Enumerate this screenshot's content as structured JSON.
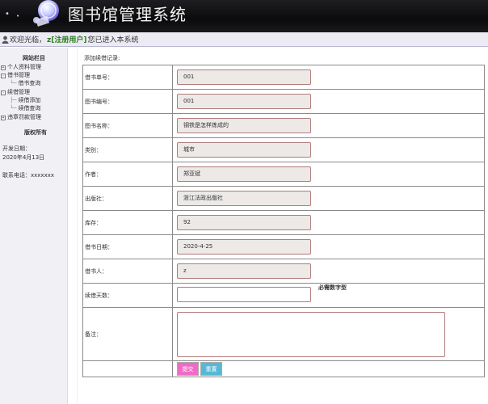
{
  "header": {
    "title": "图书馆管理系统"
  },
  "welcome": {
    "prefix": "欢迎光临，",
    "username": "z[注册用户]",
    "suffix": "您已进入本系统"
  },
  "sidebar": {
    "title": "网站栏目",
    "tree": [
      {
        "label": "个人资料管理",
        "toggle": "+",
        "level": 0
      },
      {
        "label": "借书管理",
        "toggle": "-",
        "level": 0
      },
      {
        "label": "借书查询",
        "toggle": "",
        "level": 1
      },
      {
        "label": "续借管理",
        "toggle": "-",
        "level": 0
      },
      {
        "label": "续借添加",
        "toggle": "",
        "level": 1
      },
      {
        "label": "续借查询",
        "toggle": "",
        "level": 1
      },
      {
        "label": "违章罚款管理",
        "toggle": "+",
        "level": 0
      }
    ],
    "copyright": "版权所有",
    "dev_date_label": "开发日期：",
    "dev_date_value": "2020年4月13日",
    "contact": "联系电话：xxxxxxx"
  },
  "main": {
    "section_title": "添加续借记录:",
    "fields": [
      {
        "label": "借书单号：",
        "value": "001"
      },
      {
        "label": "图书编号：",
        "value": "001"
      },
      {
        "label": "图书名称：",
        "value": "钢铁是怎样炼成的"
      },
      {
        "label": "类别：",
        "value": "城市"
      },
      {
        "label": "作者：",
        "value": "郑亚斌"
      },
      {
        "label": "出版社：",
        "value": "浙江法政出版社"
      },
      {
        "label": "库存：",
        "value": "92"
      },
      {
        "label": "借书日期：",
        "value": "2020-4-25"
      },
      {
        "label": "借书人：",
        "value": "z"
      }
    ],
    "renew_days": {
      "label": "续借天数：",
      "value": "",
      "hint": "必需数字型"
    },
    "remarks": {
      "label": "备注：",
      "value": ""
    },
    "buttons": {
      "submit": "提交",
      "reset": "重置"
    }
  },
  "colors": {
    "header_bg": "#0b0b0d",
    "submit": "#f06ac6",
    "reset": "#57b8d6",
    "username": "#2b7d1f"
  }
}
